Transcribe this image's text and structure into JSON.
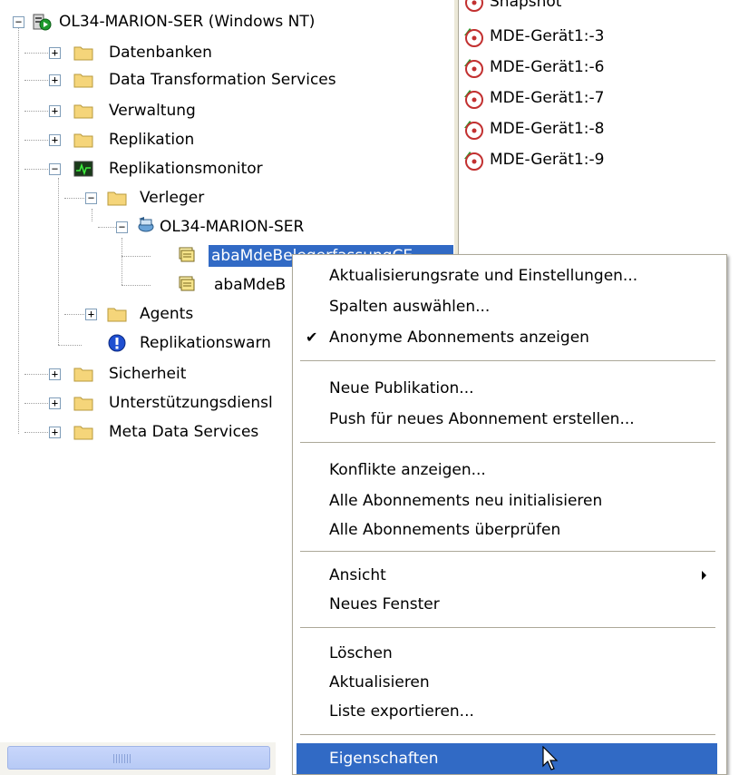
{
  "tree": {
    "items": [
      {
        "label": "OL34-MARION-SER (Windows NT)",
        "icon": "server-icon"
      },
      {
        "label": "Datenbanken",
        "icon": "folder-icon"
      },
      {
        "label": "Data Transformation Services",
        "icon": "folder-icon"
      },
      {
        "label": "Verwaltung",
        "icon": "folder-icon"
      },
      {
        "label": "Replikation",
        "icon": "folder-icon"
      },
      {
        "label": "Replikationsmonitor",
        "icon": "monitor-icon"
      },
      {
        "label": "Verleger",
        "icon": "folder-icon"
      },
      {
        "label": "OL34-MARION-SER",
        "icon": "publisher-icon"
      },
      {
        "label": "abaMdeBelegerfassungCE",
        "icon": "publication-icon"
      },
      {
        "label": "abaMdeB",
        "icon": "publication-icon"
      },
      {
        "label": "Agents",
        "icon": "folder-icon"
      },
      {
        "label": "Replikationswarn",
        "icon": "alert-icon"
      },
      {
        "label": "Sicherheit",
        "icon": "folder-icon"
      },
      {
        "label": "Unterstützungsdiensl",
        "icon": "folder-icon"
      },
      {
        "label": "Meta Data Services",
        "icon": "folder-icon"
      }
    ]
  },
  "list": {
    "items": [
      {
        "label": "Snapshot"
      },
      {
        "label": "MDE-Gerät1:-3"
      },
      {
        "label": "MDE-Gerät1:-6"
      },
      {
        "label": "MDE-Gerät1:-7"
      },
      {
        "label": "MDE-Gerät1:-8"
      },
      {
        "label": "MDE-Gerät1:-9"
      }
    ]
  },
  "menu": {
    "items": [
      {
        "label": "Aktualisierungsrate und Einstellungen..."
      },
      {
        "label": "Spalten auswählen..."
      },
      {
        "label": "Anonyme Abonnements anzeigen",
        "checked": true
      },
      {
        "label": "Neue Publikation..."
      },
      {
        "label": "Push für neues Abonnement erstellen..."
      },
      {
        "label": "Konflikte anzeigen..."
      },
      {
        "label": "Alle Abonnements neu initialisieren"
      },
      {
        "label": "Alle Abonnements überprüfen"
      },
      {
        "label": "Ansicht",
        "submenu": true
      },
      {
        "label": "Neues Fenster"
      },
      {
        "label": "Löschen"
      },
      {
        "label": "Aktualisieren"
      },
      {
        "label": "Liste exportieren..."
      },
      {
        "label": "Eigenschaften",
        "highlighted": true
      }
    ]
  },
  "colors": {
    "selection": "#316ac5",
    "folder": "#f5d57a",
    "menu_border": "#aca899"
  }
}
